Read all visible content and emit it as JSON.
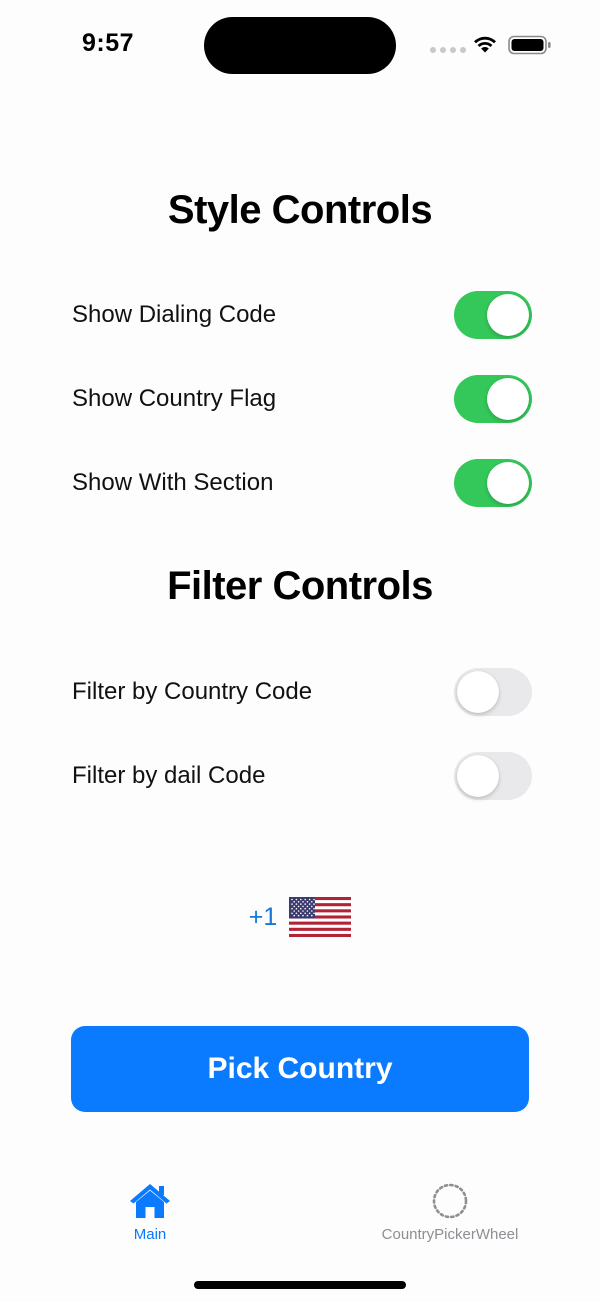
{
  "status_bar": {
    "time": "9:57"
  },
  "style_section": {
    "title": "Style Controls",
    "rows": [
      {
        "label": "Show Dialing Code",
        "on": true
      },
      {
        "label": "Show Country Flag",
        "on": true
      },
      {
        "label": "Show With Section",
        "on": true
      }
    ]
  },
  "filter_section": {
    "title": "Filter Controls",
    "rows": [
      {
        "label": "Filter by Country Code",
        "on": false
      },
      {
        "label": "Filter by dail Code",
        "on": false
      }
    ]
  },
  "selected_country": {
    "dial_code": "+1",
    "flag_icon": "us-flag-icon"
  },
  "pick_button": {
    "label": "Pick Country"
  },
  "tab_bar": {
    "tabs": [
      {
        "label": "Main",
        "icon": "house-icon",
        "selected": true
      },
      {
        "label": "CountryPickerWheel",
        "icon": "dotted-circle-icon",
        "selected": false
      }
    ]
  },
  "colors": {
    "accent": "#0a7aff",
    "toggle_on": "#34c759",
    "toggle_off": "#e9e9eb",
    "dial_code": "#1777d8"
  }
}
